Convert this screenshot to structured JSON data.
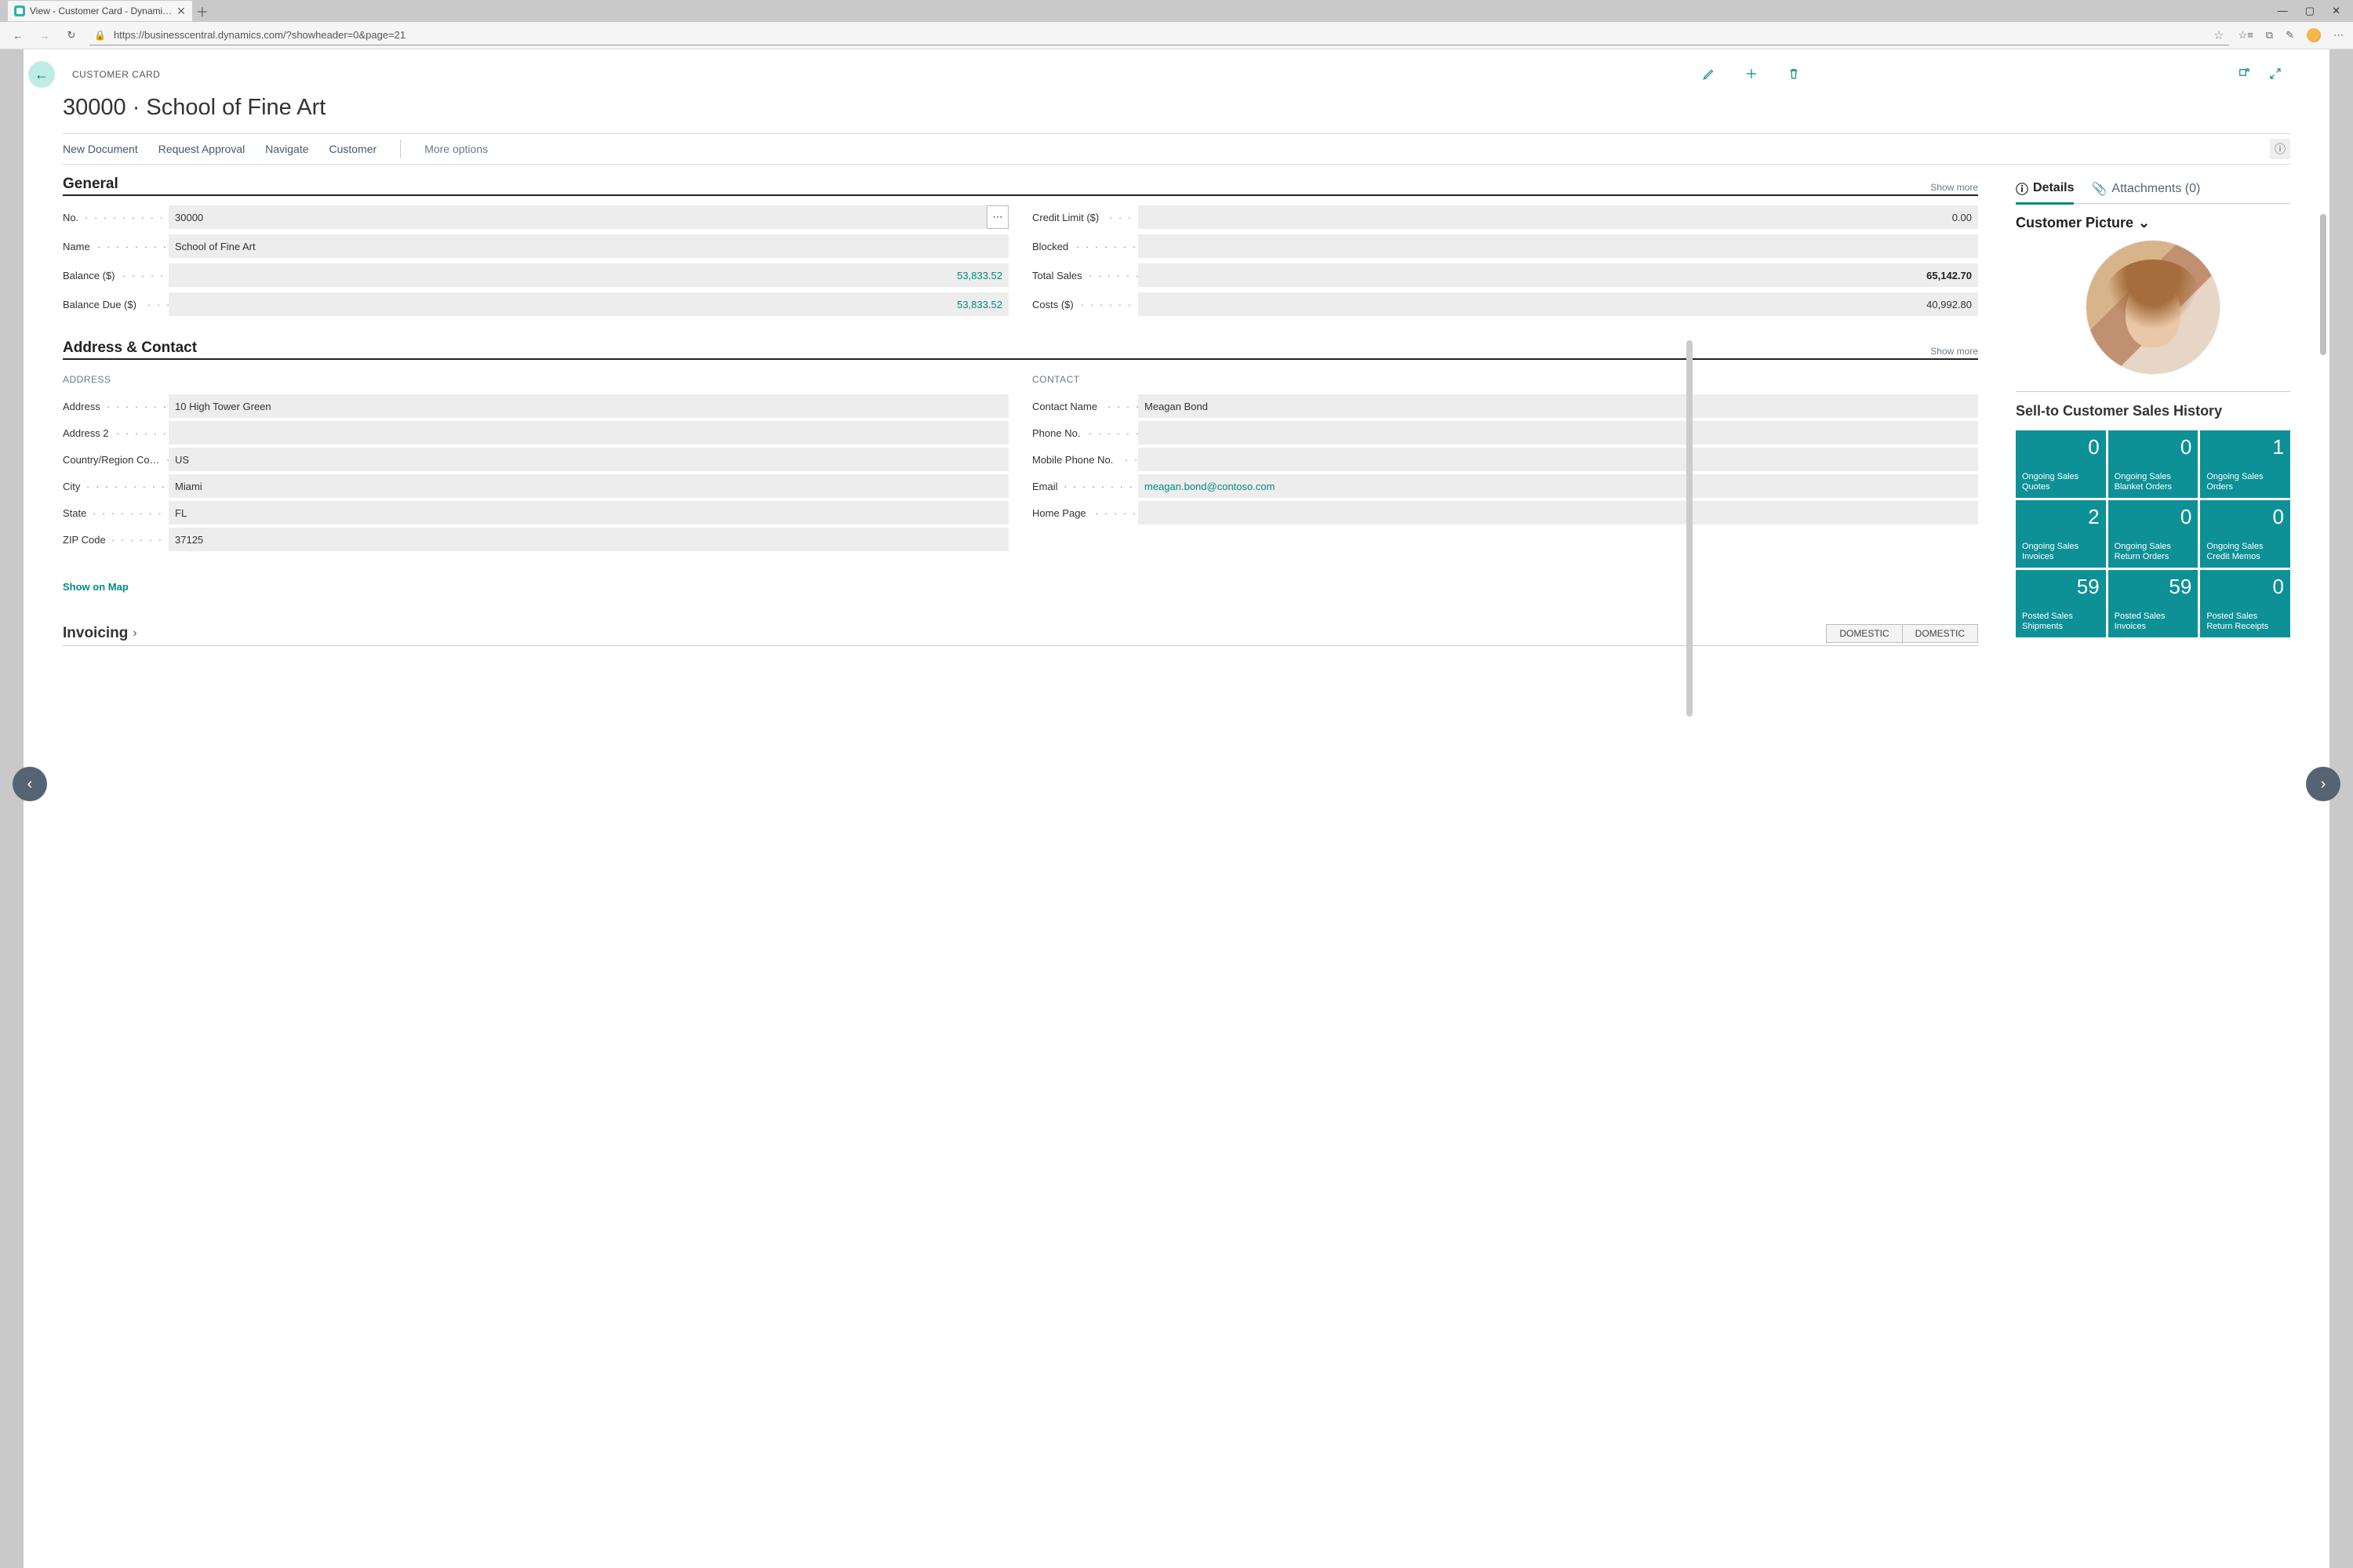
{
  "browser": {
    "tab_title": "View - Customer Card - Dynami…",
    "url": "https://businesscentral.dynamics.com/?showheader=0&page=21"
  },
  "header": {
    "crumb": "CUSTOMER CARD",
    "title": "30000 · School of Fine Art"
  },
  "menu": {
    "new_document": "New Document",
    "request_approval": "Request Approval",
    "navigate": "Navigate",
    "customer": "Customer",
    "more_options": "More options"
  },
  "general": {
    "heading": "General",
    "show_more": "Show more",
    "no_label": "No.",
    "no_value": "30000",
    "name_label": "Name",
    "name_value": "School of Fine Art",
    "balance_label": "Balance ($)",
    "balance_value": "53,833.52",
    "balance_due_label": "Balance Due ($)",
    "balance_due_value": "53,833.52",
    "credit_limit_label": "Credit Limit ($)",
    "credit_limit_value": "0.00",
    "blocked_label": "Blocked",
    "blocked_value": "",
    "total_sales_label": "Total Sales",
    "total_sales_value": "65,142.70",
    "costs_label": "Costs ($)",
    "costs_value": "40,992.80"
  },
  "address_contact": {
    "heading": "Address & Contact",
    "show_more": "Show more",
    "address_sub": "ADDRESS",
    "contact_sub": "CONTACT",
    "address_label": "Address",
    "address_value": "10 High Tower Green",
    "address2_label": "Address 2",
    "address2_value": "",
    "country_label": "Country/Region Co…",
    "country_value": "US",
    "city_label": "City",
    "city_value": "Miami",
    "state_label": "State",
    "state_value": "FL",
    "zip_label": "ZIP Code",
    "zip_value": "37125",
    "contact_name_label": "Contact Name",
    "contact_name_value": "Meagan Bond",
    "phone_label": "Phone No.",
    "phone_value": "",
    "mobile_label": "Mobile Phone No.",
    "mobile_value": "",
    "email_label": "Email",
    "email_value": "meagan.bond@contoso.com",
    "homepage_label": "Home Page",
    "homepage_value": "",
    "map_link": "Show on Map"
  },
  "invoicing": {
    "heading": "Invoicing",
    "tag1": "DOMESTIC",
    "tag2": "DOMESTIC"
  },
  "right": {
    "details_tab": "Details",
    "attachments_tab": "Attachments (0)",
    "picture_heading": "Customer Picture",
    "history_heading": "Sell-to Customer Sales History",
    "tiles": [
      {
        "num": "0",
        "lab": "Ongoing Sales Quotes"
      },
      {
        "num": "0",
        "lab": "Ongoing Sales Blanket Orders"
      },
      {
        "num": "1",
        "lab": "Ongoing Sales Orders"
      },
      {
        "num": "2",
        "lab": "Ongoing Sales Invoices"
      },
      {
        "num": "0",
        "lab": "Ongoing Sales Return Orders"
      },
      {
        "num": "0",
        "lab": "Ongoing Sales Credit Memos"
      },
      {
        "num": "59",
        "lab": "Posted Sales Shipments"
      },
      {
        "num": "59",
        "lab": "Posted Sales Invoices"
      },
      {
        "num": "0",
        "lab": "Posted Sales Return Receipts"
      }
    ]
  }
}
